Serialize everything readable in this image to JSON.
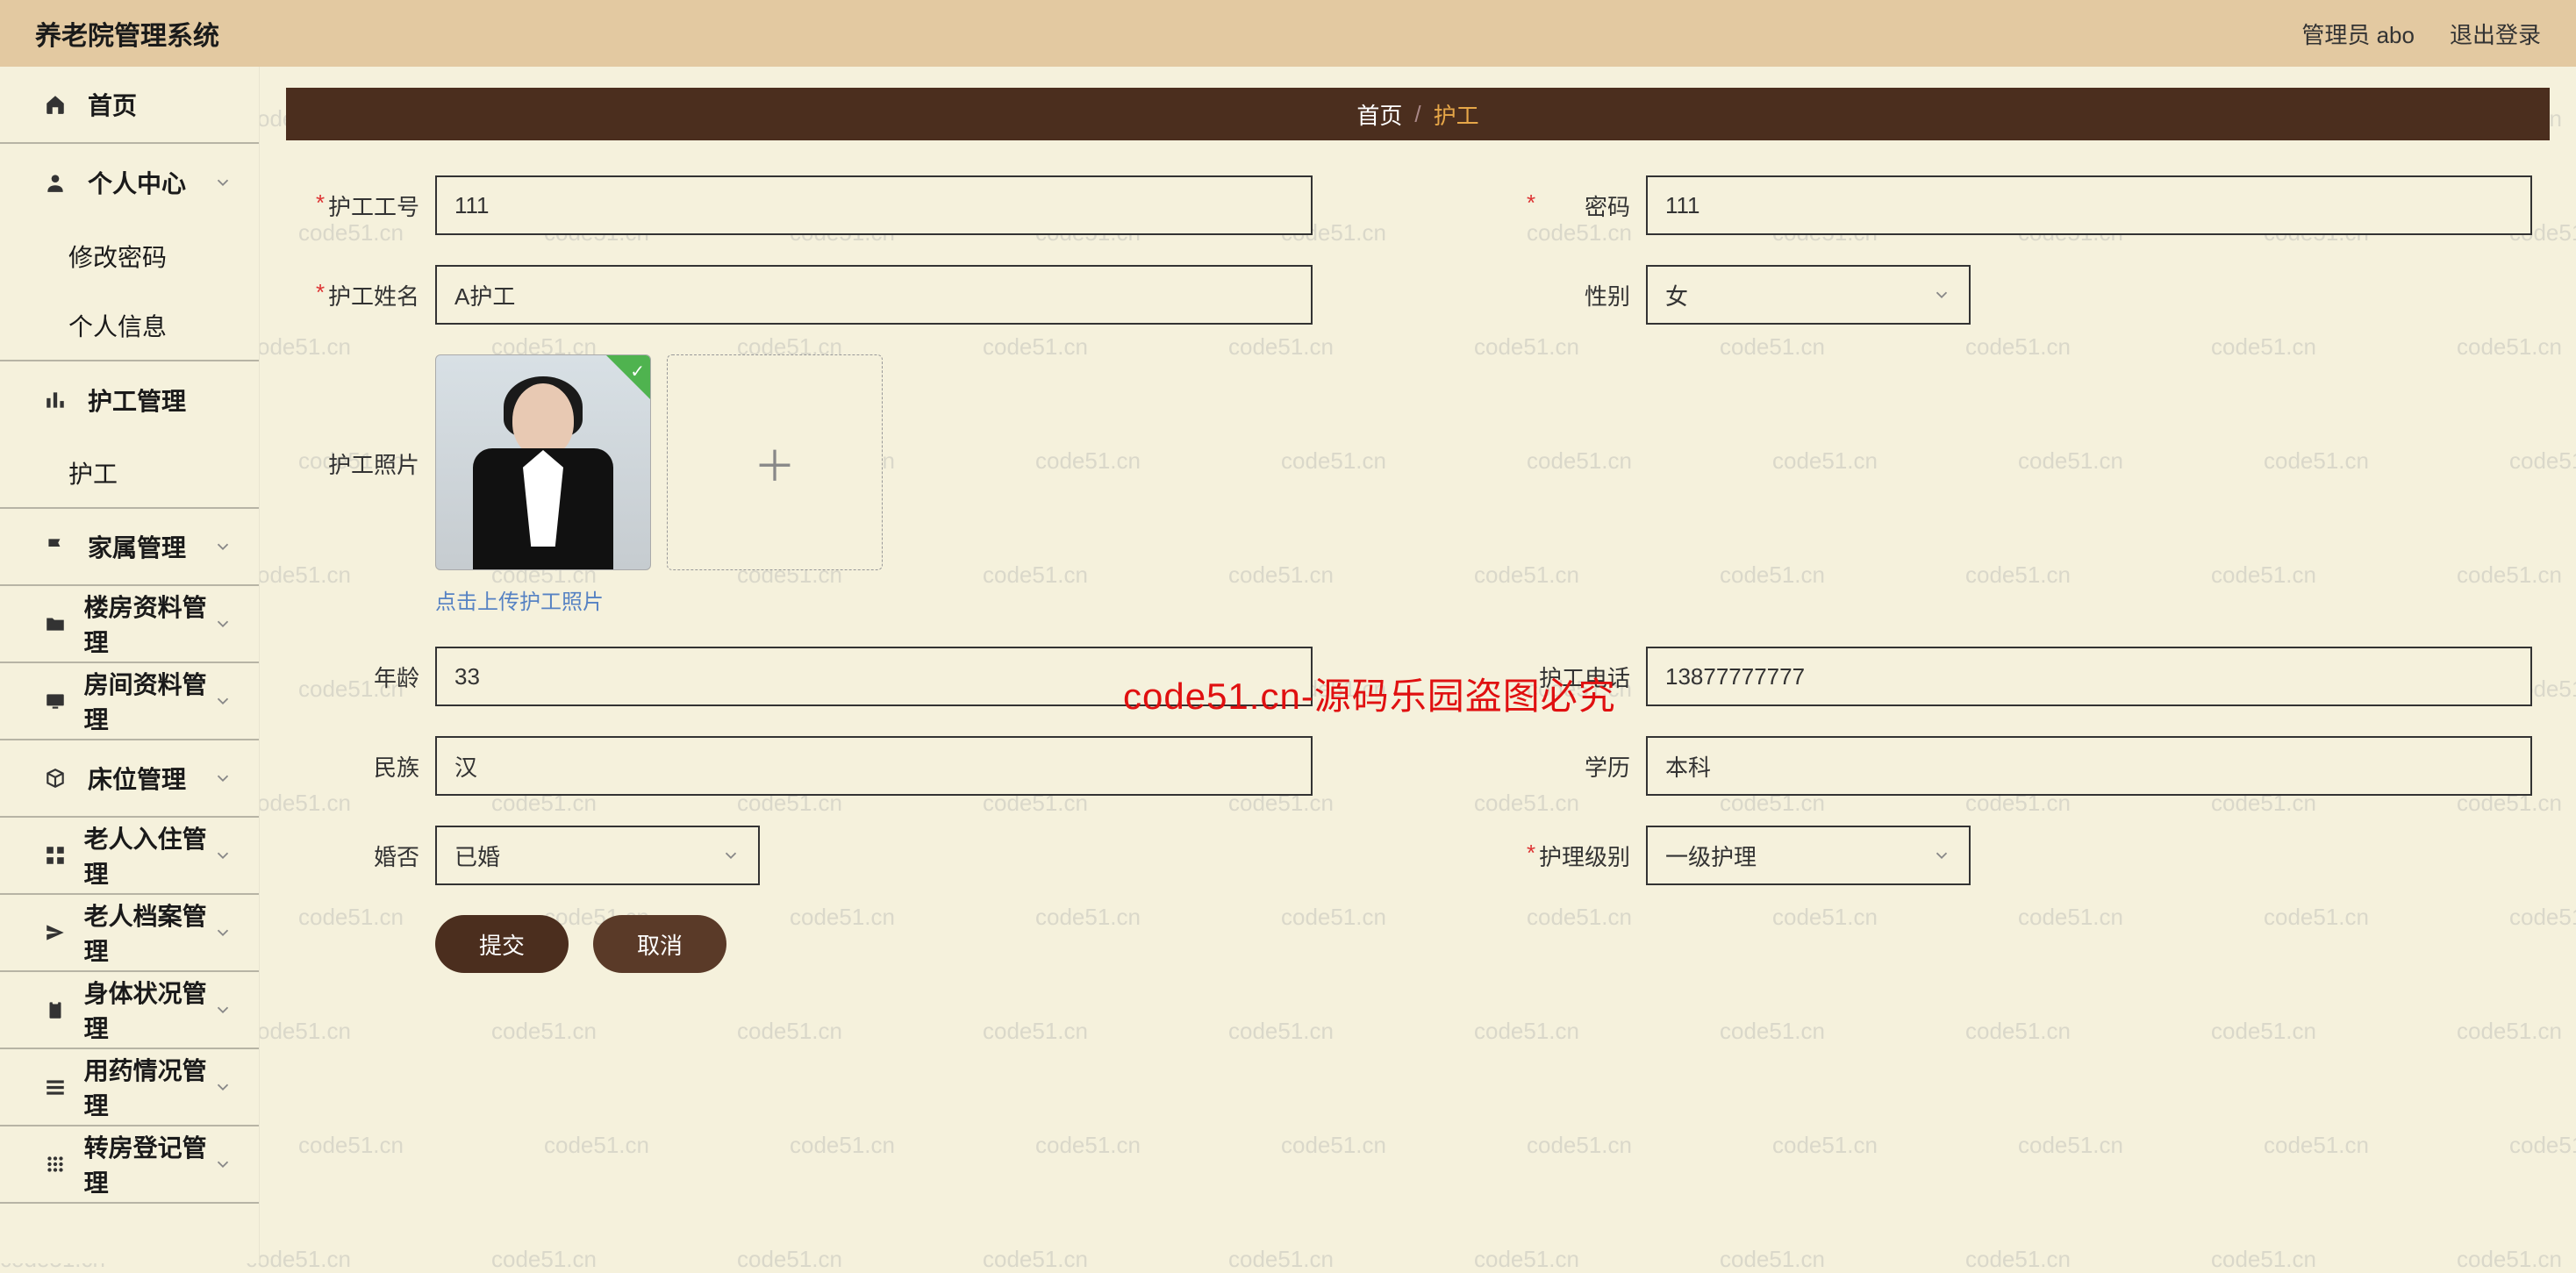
{
  "header": {
    "title": "养老院管理系统",
    "admin_label": "管理员 abo",
    "logout_label": "退出登录"
  },
  "sidebar": {
    "home": "首页",
    "personal": "个人中心",
    "change_pw": "修改密码",
    "profile": "个人信息",
    "caregiver_mgmt": "护工管理",
    "caregiver": "护工",
    "family": "家属管理",
    "building": "楼房资料管理",
    "room": "房间资料管理",
    "bed": "床位管理",
    "checkin": "老人入住管理",
    "archive": "老人档案管理",
    "health": "身体状况管理",
    "medication": "用药情况管理",
    "transfer": "转房登记管理"
  },
  "breadcrumb": {
    "home": "首页",
    "current": "护工"
  },
  "form": {
    "labels": {
      "worker_id": "护工工号",
      "password": "密码",
      "worker_name": "护工姓名",
      "gender": "性别",
      "photo": "护工照片",
      "age": "年龄",
      "phone": "护工电话",
      "ethnicity": "民族",
      "education": "学历",
      "marital": "婚否",
      "care_level": "护理级别"
    },
    "values": {
      "worker_id": "111",
      "password": "111",
      "worker_name": "A护工",
      "gender": "女",
      "age": "33",
      "phone": "13877777777",
      "ethnicity": "汉",
      "education": "本科",
      "marital": "已婚",
      "care_level": "一级护理"
    },
    "hint": "点击上传护工照片"
  },
  "buttons": {
    "submit": "提交",
    "cancel": "取消"
  },
  "watermark_red": "code51.cn-源码乐园盗图必究"
}
